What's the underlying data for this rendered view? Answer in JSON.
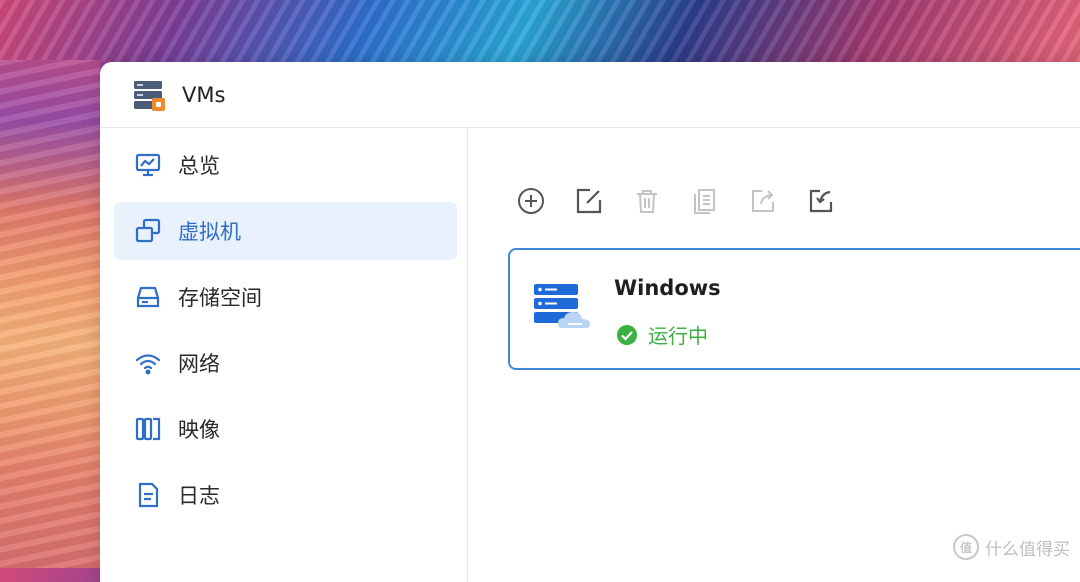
{
  "window": {
    "title": "VMs"
  },
  "sidebar": {
    "items": [
      {
        "label": "总览",
        "icon": "monitor-chart-icon"
      },
      {
        "label": "虚拟机",
        "icon": "vm-copy-icon",
        "active": true
      },
      {
        "label": "存储空间",
        "icon": "disk-drive-icon"
      },
      {
        "label": "网络",
        "icon": "wifi-icon"
      },
      {
        "label": "映像",
        "icon": "image-layers-icon"
      },
      {
        "label": "日志",
        "icon": "document-icon"
      }
    ]
  },
  "toolbar": {
    "buttons": [
      {
        "icon": "add-circle-icon",
        "enabled": true
      },
      {
        "icon": "edit-icon",
        "enabled": true
      },
      {
        "icon": "trash-icon",
        "enabled": false
      },
      {
        "icon": "clone-icon",
        "enabled": false
      },
      {
        "icon": "export-icon",
        "enabled": false
      },
      {
        "icon": "import-icon",
        "enabled": true
      }
    ]
  },
  "vm": {
    "name": "Windows",
    "status": "运行中",
    "status_color": "#3cb043"
  },
  "colors": {
    "accent": "#2f6fc9",
    "card_border": "#3f86d6",
    "active_bg": "#e8f1fc"
  },
  "watermark": {
    "text": "什么值得买",
    "logo": "值"
  }
}
